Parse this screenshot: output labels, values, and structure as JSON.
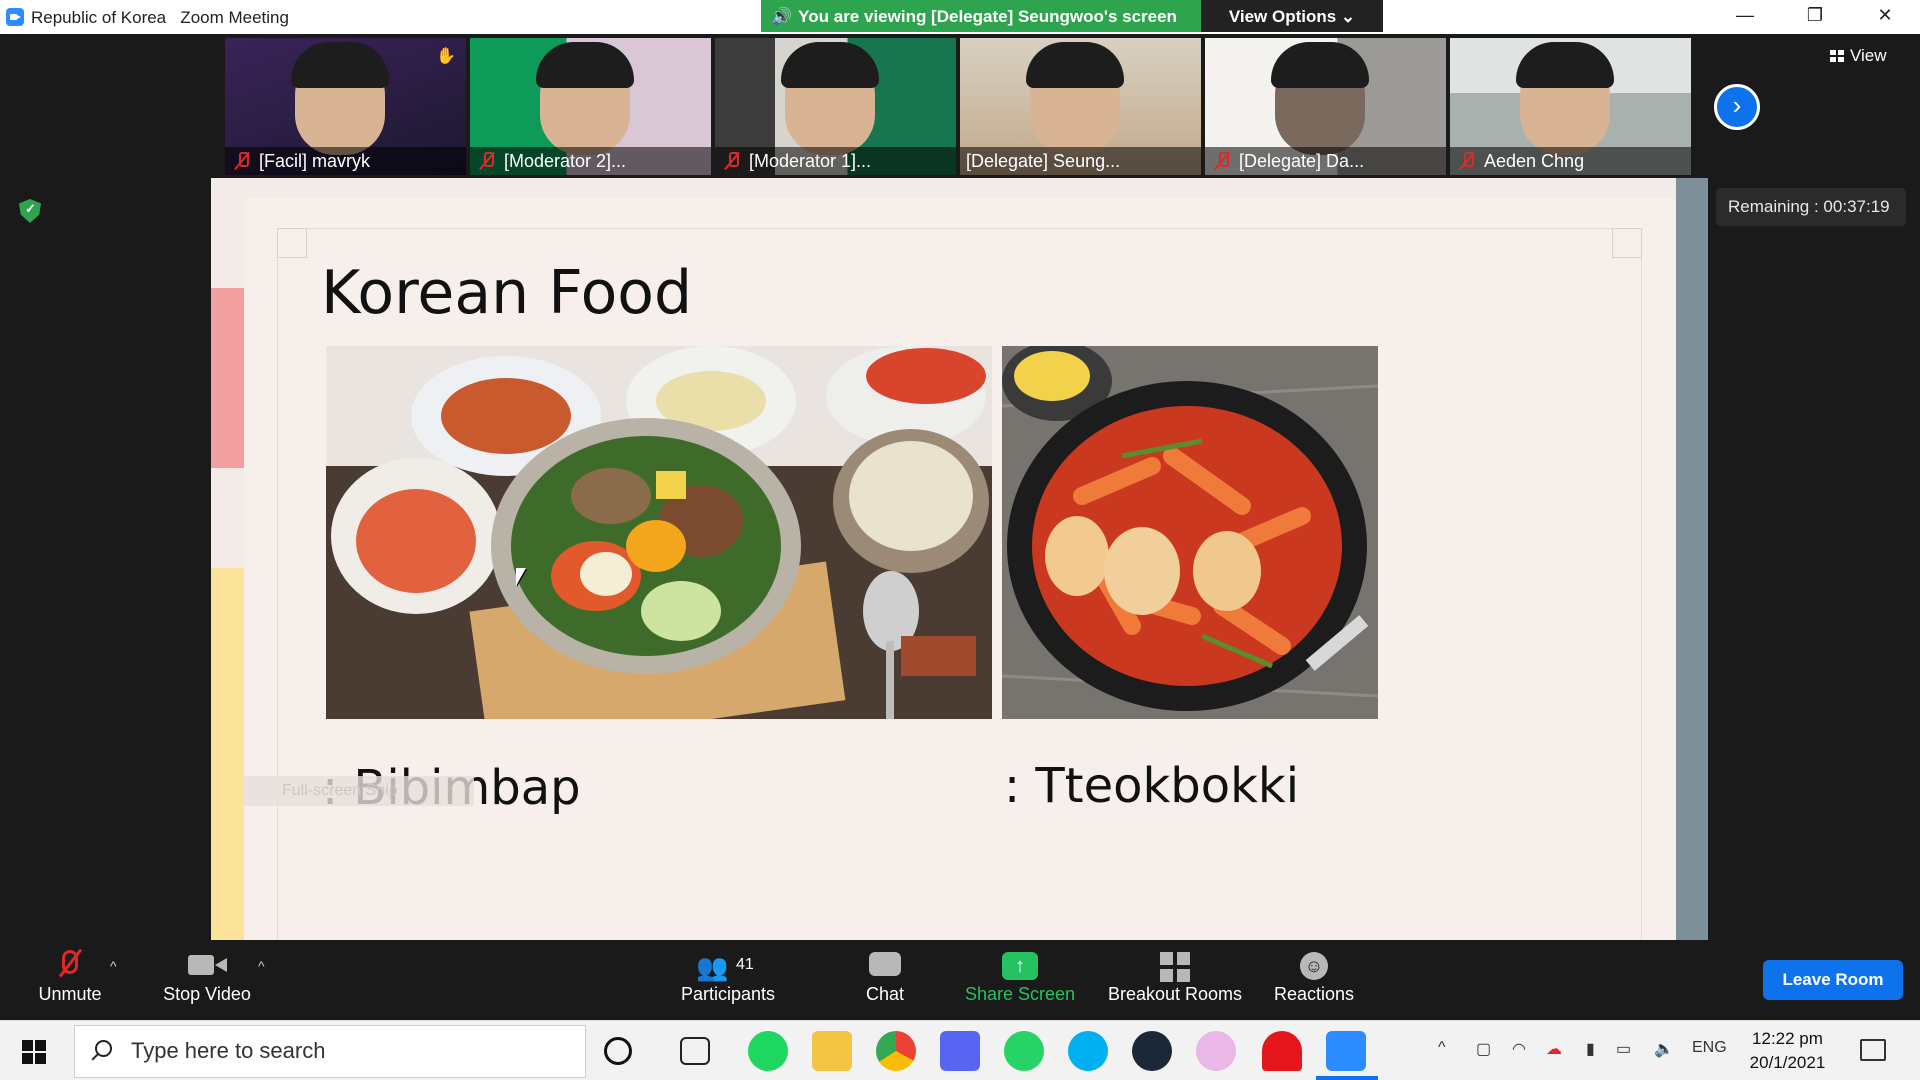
{
  "window": {
    "title": "Republic of Korea   Zoom Meeting",
    "viewing_banner": "You are viewing [Delegate] Seungwoo's screen",
    "view_options": "View Options ⌄",
    "controls": [
      "minimize-icon",
      "restore-icon",
      "close-icon"
    ]
  },
  "thumbnails": [
    {
      "name": "[Facil] mavryk",
      "muted": true,
      "bg": "#2b1f45"
    },
    {
      "name": "[Moderator 2]...",
      "muted": true,
      "bg": "#129a5e"
    },
    {
      "name": "[Moderator 1]...",
      "muted": true,
      "bg": "#1d6b4e"
    },
    {
      "name": "[Delegate] Seung...",
      "muted": false,
      "bg": "#cbbfae",
      "active": true
    },
    {
      "name": "[Delegate] Da...",
      "muted": true,
      "bg": "#e8e6e2"
    },
    {
      "name": "Aeden Chng",
      "muted": true,
      "bg": "#bfc6c3"
    }
  ],
  "top_right": {
    "view_label": "View",
    "remaining": "Remaining : 00:37:19"
  },
  "slide": {
    "title": "Korean Food",
    "items": [
      {
        "caption": ": Bibimbap"
      },
      {
        "caption": ": Tteokbokki"
      }
    ],
    "snip_hint": "Full-screen Snip"
  },
  "toolbar": {
    "unmute": "Unmute",
    "stop_video": "Stop Video",
    "participants": "Participants",
    "participants_count": "41",
    "chat": "Chat",
    "share_screen": "Share Screen",
    "breakout_rooms": "Breakout Rooms",
    "reactions": "Reactions",
    "leave_room": "Leave Room"
  },
  "taskbar": {
    "search_placeholder": "Type here to search",
    "language": "ENG",
    "time": "12:22 pm",
    "date": "20/1/2021"
  },
  "colors": {
    "zoom_blue": "#0e72ed",
    "banner_green": "#2ea44f",
    "share_green": "#26c262",
    "muted_red": "#e02828"
  }
}
